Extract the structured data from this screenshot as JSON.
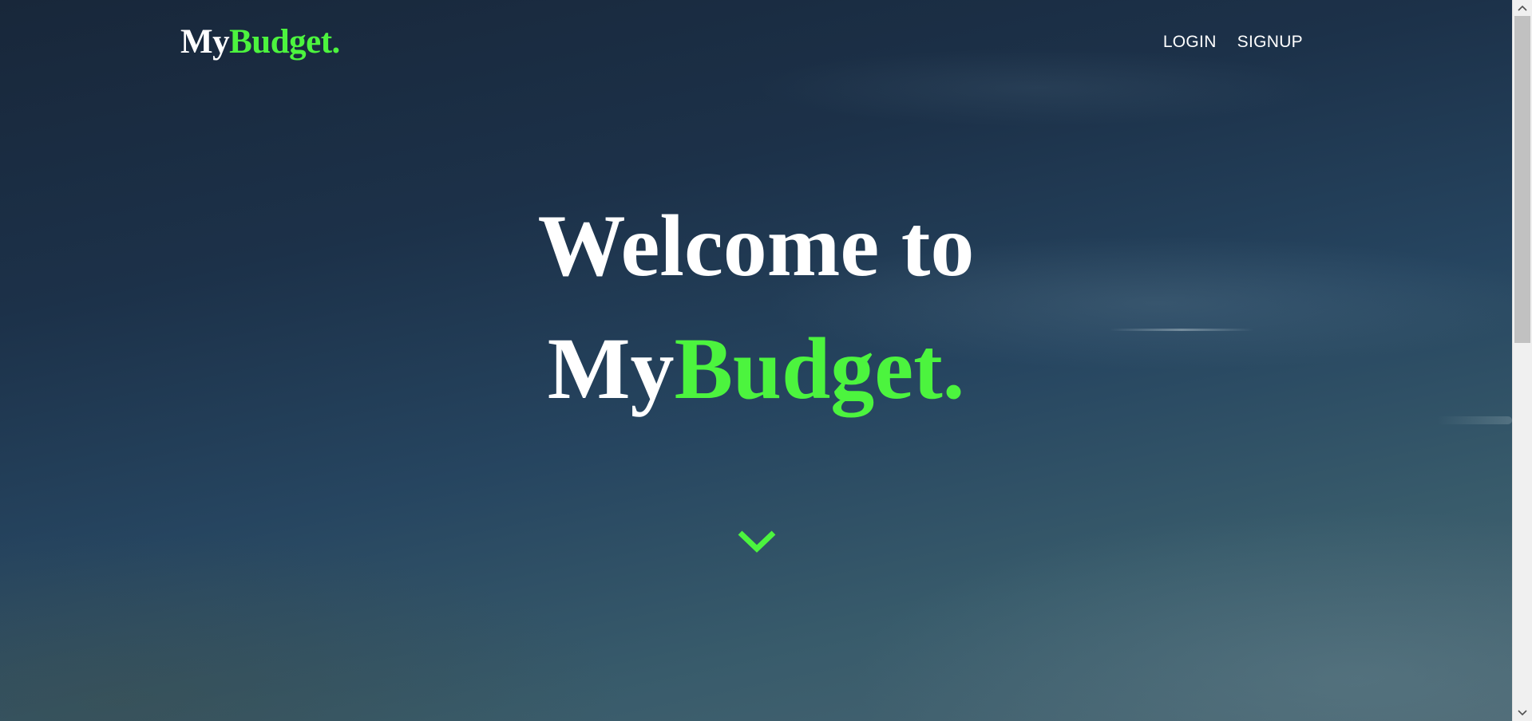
{
  "header": {
    "logo_part1": "My",
    "logo_part2": "Budget."
  },
  "nav": {
    "login_label": "LOGIN",
    "signup_label": "SIGNUP"
  },
  "hero": {
    "line1": "Welcome to",
    "brand_part1": "My",
    "brand_part2": "Budget.",
    "scroll_icon": "chevron-down-icon"
  },
  "colors": {
    "accent": "#4cf43e",
    "text": "#ffffff",
    "background_top": "#18273a",
    "background_bottom": "#4a6672"
  }
}
